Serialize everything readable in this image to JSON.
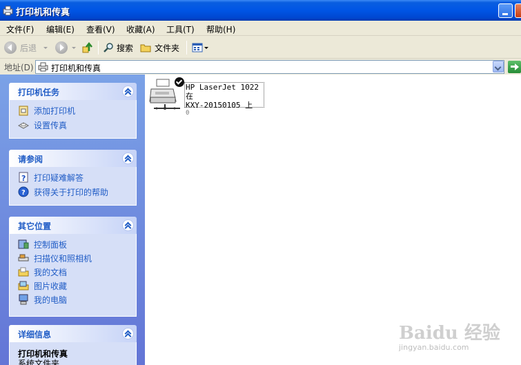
{
  "window": {
    "title": "打印机和传真"
  },
  "menu": [
    {
      "label": "文件(F)"
    },
    {
      "label": "编辑(E)"
    },
    {
      "label": "查看(V)"
    },
    {
      "label": "收藏(A)"
    },
    {
      "label": "工具(T)"
    },
    {
      "label": "帮助(H)"
    }
  ],
  "toolbar": {
    "back": "后退",
    "search": "搜索",
    "folders": "文件夹"
  },
  "address": {
    "label": "地址(D)",
    "value": "打印机和传真"
  },
  "panels": {
    "printer_tasks": {
      "title": "打印机任务",
      "items": [
        "添加打印机",
        "设置传真"
      ]
    },
    "see_also": {
      "title": "请参阅",
      "items": [
        "打印疑难解答",
        "获得关于打印的帮助"
      ]
    },
    "other_places": {
      "title": "其它位置",
      "items": [
        "控制面板",
        "扫描仪和照相机",
        "我的文档",
        "图片收藏",
        "我的电脑"
      ]
    },
    "details": {
      "title": "详细信息",
      "name": "打印机和传真",
      "type": "系统文件夹"
    }
  },
  "printer": {
    "line1": "HP LaserJet 1022 在",
    "line2": "KXY-20150105 上",
    "status": "0"
  },
  "watermark": {
    "logo": "Baidu 经验",
    "url": "jingyan.baidu.com"
  }
}
